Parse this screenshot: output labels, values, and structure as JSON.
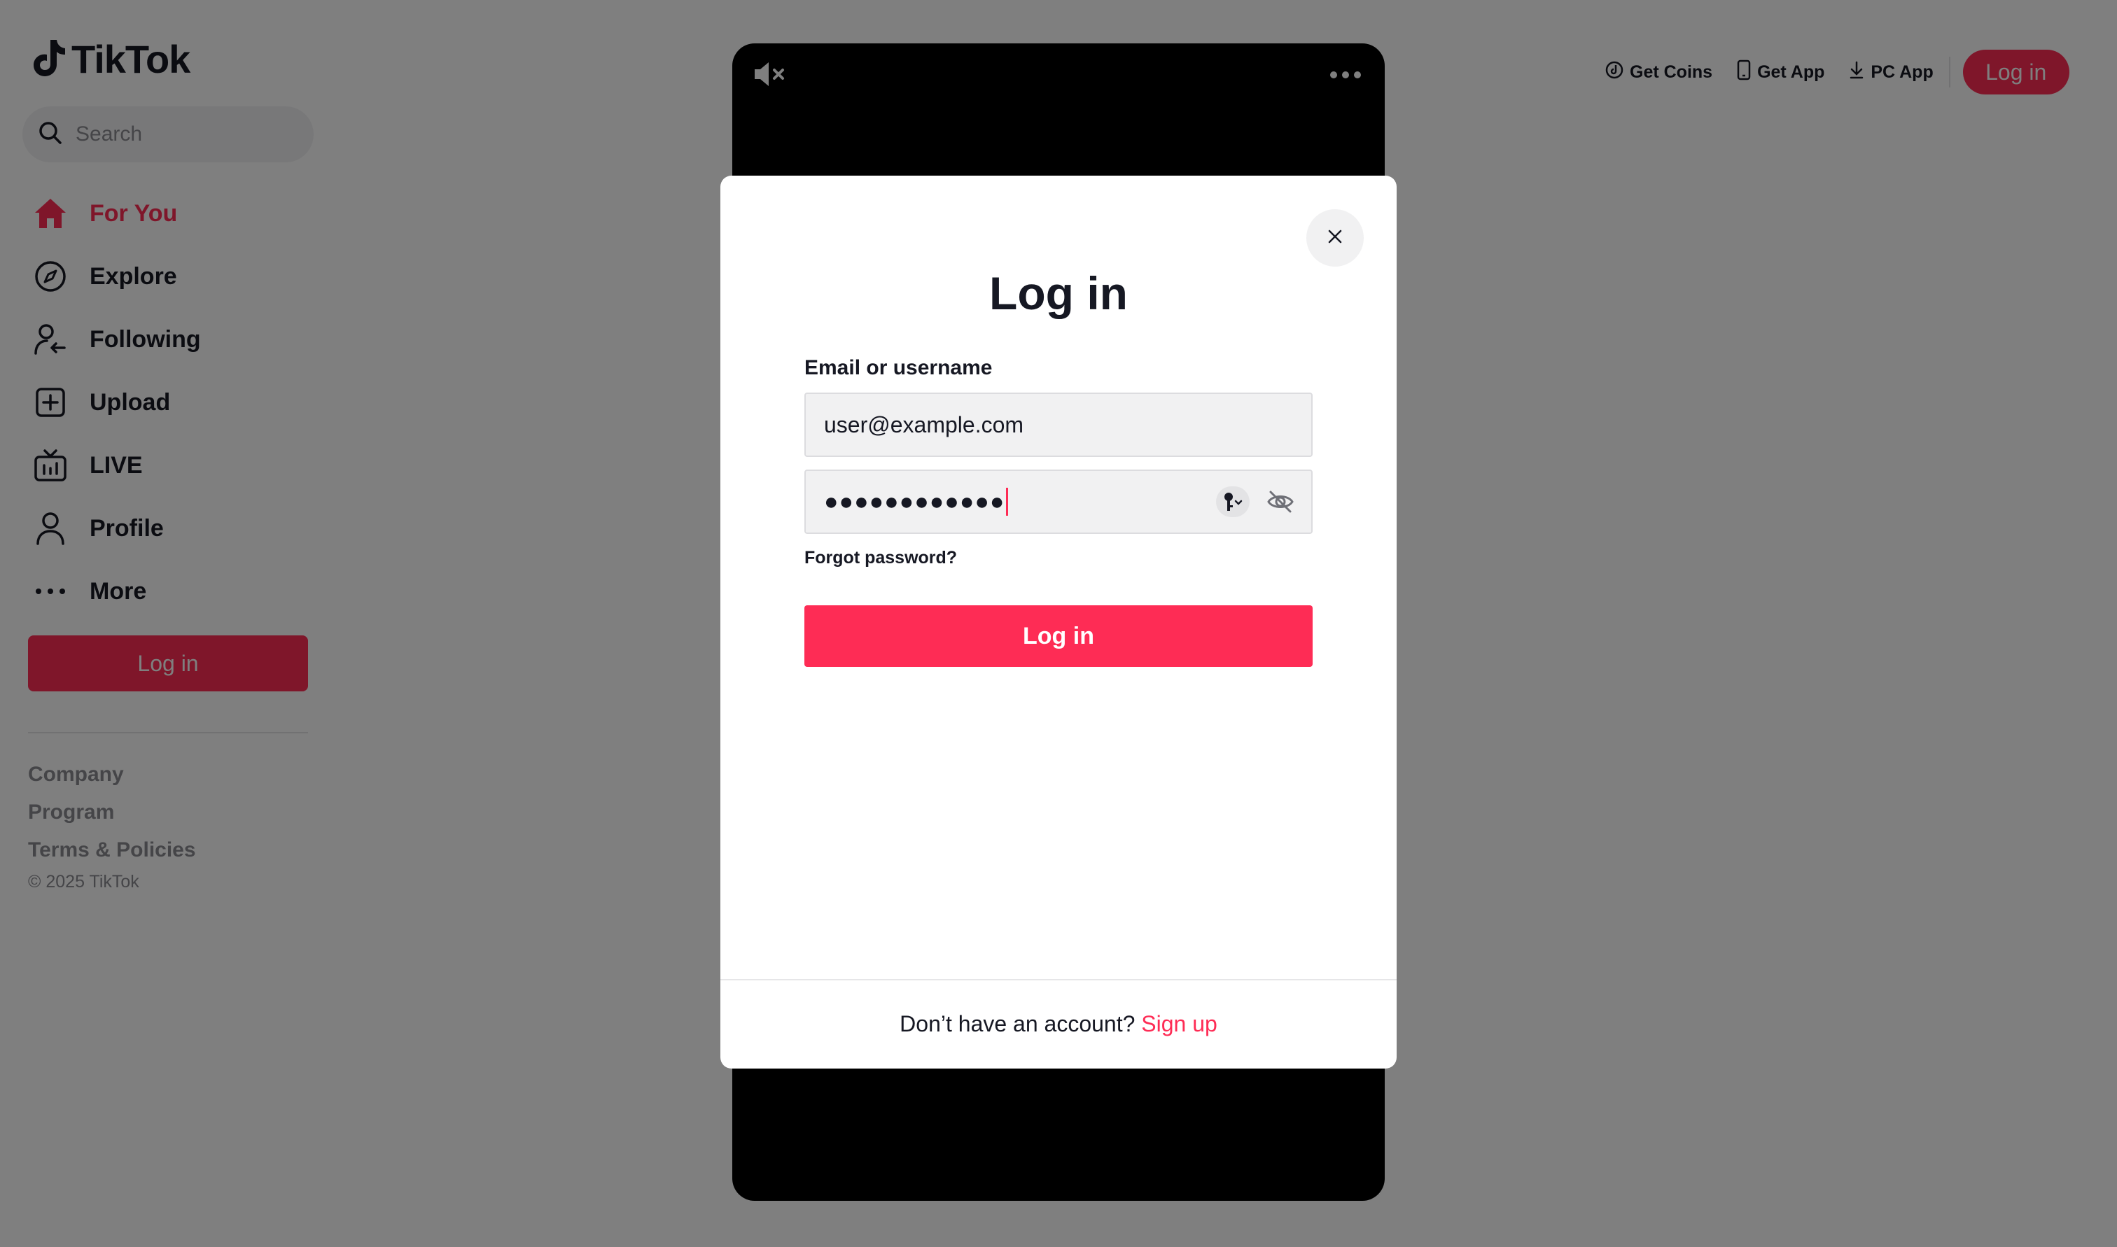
{
  "brand": {
    "name": "TikTok"
  },
  "search": {
    "placeholder": "Search"
  },
  "nav": {
    "items": [
      {
        "label": "For You",
        "icon": "home-icon",
        "active": true
      },
      {
        "label": "Explore",
        "icon": "compass-icon"
      },
      {
        "label": "Following",
        "icon": "following-icon"
      },
      {
        "label": "Upload",
        "icon": "upload-icon"
      },
      {
        "label": "LIVE",
        "icon": "live-tv-icon"
      },
      {
        "label": "Profile",
        "icon": "profile-icon"
      },
      {
        "label": "More",
        "icon": "more-dots-icon"
      }
    ]
  },
  "sidebar": {
    "login_label": "Log in"
  },
  "footer": {
    "links": [
      "Company",
      "Program",
      "Terms & Policies"
    ],
    "copyright": "© 2025 TikTok"
  },
  "topbar": {
    "get_coins": "Get Coins",
    "get_app": "Get App",
    "pc_app": "PC App",
    "login_label": "Log in"
  },
  "modal": {
    "title": "Log in",
    "email_label": "Email or username",
    "email_value": "user@example.com",
    "password_masked": "●●●●●●●●●●●●",
    "forgot_label": "Forgot password?",
    "login_label": "Log in",
    "signup_prompt": "Don’t have an account?",
    "signup_link": "Sign up"
  },
  "colors": {
    "accent": "#fe2c55",
    "text": "#161823",
    "muted": "#8a8b91",
    "input_bg": "#f1f1f2"
  }
}
